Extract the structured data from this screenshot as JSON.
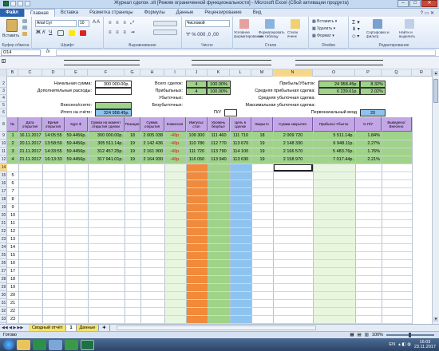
{
  "window": {
    "title": "Журнал сделок .xlt [Режим ограниченной функциональности] - Microsoft Excel (Сбой активации продукта)"
  },
  "ribbon": {
    "tabs": [
      "Файл",
      "Главная",
      "Вставка",
      "Разметка страницы",
      "Формулы",
      "Данные",
      "Рецензирование",
      "Вид"
    ],
    "active_tab": "Главная",
    "paste_label": "Вставить",
    "font_name": "Arial Cyr",
    "font_size": "10",
    "number_format": "Числовой",
    "cond_format": "Условное форматирование",
    "format_table": "Форматировать как таблицу",
    "cell_styles": "Стили ячеек",
    "insert_label": "Вставить",
    "delete_label": "Удалить",
    "format_label": "Формат",
    "sort_label": "Сортировка и фильтр",
    "find_label": "Найти и выделить",
    "groups": [
      "Буфер обмена",
      "Шрифт",
      "Выравнивание",
      "Число",
      "Стили",
      "Ячейки",
      "Редактирование"
    ]
  },
  "formula_bar": {
    "name_box": "O14",
    "fx": "fx",
    "content": ""
  },
  "columns": [
    "B",
    "C",
    "D",
    "E",
    "F",
    "G",
    "H",
    "I",
    "J",
    "K",
    "L",
    "M",
    "N",
    "O",
    "P",
    "Q",
    "R",
    "S"
  ],
  "rows": [
    "2",
    "3",
    "4",
    "5",
    "6",
    "7",
    "8",
    "9",
    "10",
    "11",
    "12",
    "13",
    "14",
    "1",
    "2",
    "3",
    "4",
    "5",
    "6",
    "7",
    "8",
    "9",
    "10",
    "11",
    "12",
    "13",
    "14",
    "15",
    "16",
    "17",
    "18",
    "19",
    "20",
    "21"
  ],
  "summary": {
    "start_sum_label": "Начальная сумма:",
    "start_sum": "300 000.00р.",
    "extra_exp_label": "Дополнительные расходы:",
    "extra_exp": "",
    "deposited_label": "Внесено/снято:",
    "deposited": "",
    "total_label": "Итого на счёте:",
    "total": "324 958.45р.",
    "total_deals_label": "Всего сделок:",
    "total_deals": "4",
    "total_deals_pct": "100.00%",
    "profitable_label": "Прибыльных:",
    "profitable": "4",
    "profitable_pct": "100.00%",
    "losing_label": "Убыточных:",
    "breakeven_label": "Безубыточных:",
    "pu_label": "П/У",
    "profit_loss_label": "Прибыль/Убыток:",
    "profit_loss": "24 958.45р.",
    "profit_loss_pct": "8.32%",
    "avg_profit_label": "Средняя прибыльная сделка:",
    "avg_profit": "6 239.61р.",
    "avg_profit_pct": "2.02%",
    "avg_loss_label": "Средняя убыточная сделка:",
    "max_loss_label": "Максимальная убыточная сделка:",
    "first_entry_label": "Первоначальный вход",
    "first_entry": "20"
  },
  "table": {
    "headers": [
      "№",
      "Дата открытия",
      "Время открытия",
      "Курс $",
      "Сумма на момент открытия сделки",
      "Позиция",
      "Сумма открытия",
      "Комиссия",
      "Импульс стоп",
      "Уровень безубыт",
      "Цель в сделке",
      "Закрыто",
      "Сумма закрытия",
      "Прибыль/ Убыток",
      "% П/У",
      "Выведено/ Внесено"
    ],
    "rows": [
      {
        "n": "1",
        "date": "16.11.2017",
        "time": "14:05:55",
        "rate": "59.4456р.",
        "sum_open": "300 000.00р.",
        "pos": "18",
        "open_sum": "2 005 038",
        "comm": "-49р.",
        "stop": "109 300",
        "be": "111 460",
        "target": "111 710",
        "closed": "18",
        "close_sum": "2 009 720",
        "pl": "5 511.14р.",
        "pct": "1.84%"
      },
      {
        "n": "2",
        "date": "20.11.2017",
        "time": "13:58:59",
        "rate": "59.4456р.",
        "sum_open": "305 511.14р.",
        "pos": "19",
        "open_sum": "2 142 436",
        "comm": "-49р.",
        "stop": "110 780",
        "be": "112 770",
        "target": "113 670",
        "closed": "19",
        "close_sum": "2 148 330",
        "pl": "6 948.11р.",
        "pct": "2.27%"
      },
      {
        "n": "3",
        "date": "21.11.2017",
        "time": "14:33:55",
        "rate": "59.4456р.",
        "sum_open": "312 457.25р.",
        "pos": "19",
        "open_sum": "2 161 900",
        "comm": "-49р.",
        "stop": "111 720",
        "be": "113 790",
        "target": "114 100",
        "closed": "19",
        "close_sum": "2 166 570",
        "pl": "5 483.76р.",
        "pct": "1.76%"
      },
      {
        "n": "4",
        "date": "21.11.2017",
        "time": "16:13:33",
        "rate": "59.4456р.",
        "sum_open": "317 941.01р.",
        "pos": "19",
        "open_sum": "2 164 930",
        "comm": "-49р.",
        "stop": "116 050",
        "be": "113 940",
        "target": "113 630",
        "closed": "19",
        "close_sum": "2 158 970",
        "pl": "7 017.44р.",
        "pct": "2.21%"
      }
    ],
    "empty_row_numbers": [
      "5",
      "6",
      "7",
      "8",
      "9",
      "10",
      "11",
      "12",
      "13",
      "14",
      "15",
      "16",
      "17",
      "18",
      "19",
      "20",
      "21",
      "22",
      "23"
    ]
  },
  "sheet_tabs": [
    "Сводный отчёт",
    "1",
    "Данные"
  ],
  "status": {
    "ready": "Готово",
    "zoom": "100%"
  },
  "taskbar": {
    "lang": "EN",
    "time": "16:03",
    "date": "23.11.2017"
  },
  "colors": {
    "green": "#9fd389",
    "purple": "#c3a6e6",
    "orange": "#f08a3c",
    "blue": "#8fc3ef",
    "cyan": "#7fd0f4"
  }
}
